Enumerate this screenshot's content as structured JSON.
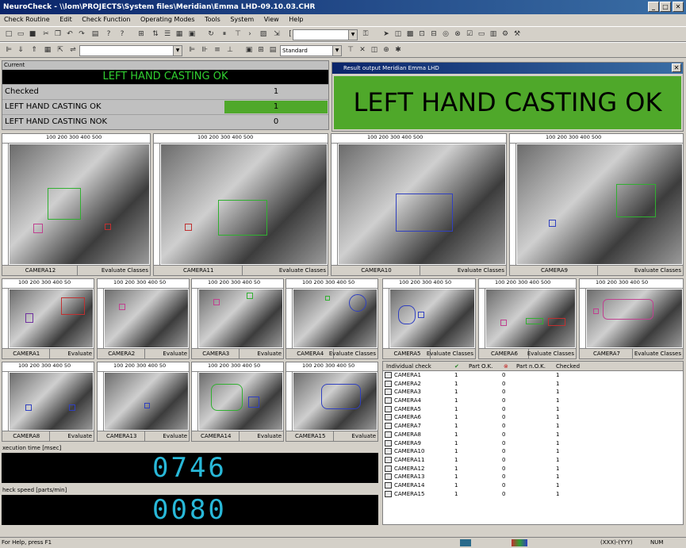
{
  "window": {
    "title": "NeuroCheck - \\\\lom\\PROJECTS\\System files\\Meridian\\Emma LHD-09.10.03.CHR",
    "min": "_",
    "max": "□",
    "close": "✕"
  },
  "menu": [
    "Check Routine",
    "Edit",
    "Check Function",
    "Operating Modes",
    "Tools",
    "System",
    "View",
    "Help"
  ],
  "toolbar": {
    "combo2": "Standard"
  },
  "current": {
    "title": "Current",
    "banner": "LEFT HAND CASTING OK",
    "rows": [
      {
        "label": "Checked",
        "value": "1"
      },
      {
        "label": "LEFT HAND CASTING OK",
        "value": "1"
      },
      {
        "label": "LEFT HAND CASTING NOK",
        "value": "0"
      }
    ]
  },
  "result": {
    "title": "Result output Meridian Emma LHD",
    "text": "LEFT HAND CASTING OK",
    "close": "✕"
  },
  "cameras_large": [
    {
      "name": "CAMERA12",
      "status": "Evaluate Classes",
      "ruler": "100  200  300  400  500"
    },
    {
      "name": "CAMERA11",
      "status": "Evaluate Classes",
      "ruler": "100  200  300  400  500"
    },
    {
      "name": "CAMERA10",
      "status": "Evaluate Classes",
      "ruler": "100  200  300  400  500"
    },
    {
      "name": "CAMERA9",
      "status": "Evaluate Classes",
      "ruler": "100  200  300  400  500"
    }
  ],
  "cameras_small": [
    {
      "name": "CAMERA1",
      "status": "Evaluate",
      "ruler": "100  200  300  400  50"
    },
    {
      "name": "CAMERA2",
      "status": "Evaluate",
      "ruler": "100  200  300  400  50"
    },
    {
      "name": "CAMERA3",
      "status": "Evaluate",
      "ruler": "100  200  300  400  50"
    },
    {
      "name": "CAMERA4",
      "status": "Evaluate Classes",
      "ruler": "100  200  300  400  50"
    },
    {
      "name": "CAMERA5",
      "status": "Evaluate Classes",
      "ruler": "100  200  300  400  50"
    },
    {
      "name": "CAMERA6",
      "status": "Evaluate Classes",
      "ruler": "100  200  300  400  500"
    },
    {
      "name": "CAMERA7",
      "status": "Evaluate Classes",
      "ruler": "100  200  300  400  50"
    },
    {
      "name": "CAMERA8",
      "status": "Evaluate",
      "ruler": "100  200  300  400  50"
    },
    {
      "name": "CAMERA13",
      "status": "Evaluate",
      "ruler": "100  200  300  400  50"
    },
    {
      "name": "CAMERA14",
      "status": "Evaluate",
      "ruler": "100  200  300  400  50"
    },
    {
      "name": "CAMERA15",
      "status": "Evaluate",
      "ruler": "100  200  300  400  50"
    }
  ],
  "exec": {
    "label": "xecution time [msec]",
    "value": "0746"
  },
  "speed": {
    "label": "heck speed [parts/min]",
    "value": "0080"
  },
  "table": {
    "headers": [
      "Individual check",
      "Part O.K.",
      "Part n.O.K.",
      "Checked"
    ],
    "rows": [
      {
        "name": "CAMERA1",
        "ok": "1",
        "nok": "0",
        "checked": "1"
      },
      {
        "name": "CAMERA2",
        "ok": "1",
        "nok": "0",
        "checked": "1"
      },
      {
        "name": "CAMERA3",
        "ok": "1",
        "nok": "0",
        "checked": "1"
      },
      {
        "name": "CAMERA4",
        "ok": "1",
        "nok": "0",
        "checked": "1"
      },
      {
        "name": "CAMERA5",
        "ok": "1",
        "nok": "0",
        "checked": "1"
      },
      {
        "name": "CAMERA6",
        "ok": "1",
        "nok": "0",
        "checked": "1"
      },
      {
        "name": "CAMERA7",
        "ok": "1",
        "nok": "0",
        "checked": "1"
      },
      {
        "name": "CAMERA8",
        "ok": "1",
        "nok": "0",
        "checked": "1"
      },
      {
        "name": "CAMERA9",
        "ok": "1",
        "nok": "0",
        "checked": "1"
      },
      {
        "name": "CAMERA10",
        "ok": "1",
        "nok": "0",
        "checked": "1"
      },
      {
        "name": "CAMERA11",
        "ok": "1",
        "nok": "0",
        "checked": "1"
      },
      {
        "name": "CAMERA12",
        "ok": "1",
        "nok": "0",
        "checked": "1"
      },
      {
        "name": "CAMERA13",
        "ok": "1",
        "nok": "0",
        "checked": "1"
      },
      {
        "name": "CAMERA14",
        "ok": "1",
        "nok": "0",
        "checked": "1"
      },
      {
        "name": "CAMERA15",
        "ok": "1",
        "nok": "0",
        "checked": "1"
      }
    ]
  },
  "status": {
    "help": "For Help, press F1",
    "coords": "(XXX)-(YYY)",
    "num": "NUM"
  }
}
